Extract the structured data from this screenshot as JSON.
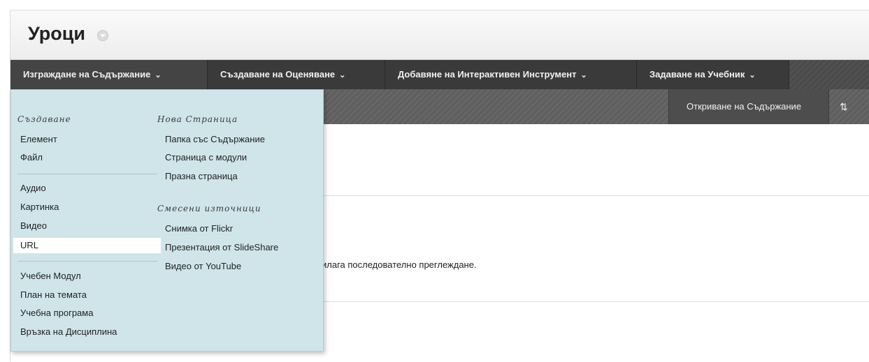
{
  "page": {
    "title": "Уроци"
  },
  "action_bar": {
    "items": [
      {
        "label": "Изграждане на Съдържание",
        "chevron": "⌄"
      },
      {
        "label": "Създаване на Оценяване",
        "chevron": "⌄"
      },
      {
        "label": "Добавяне на Интерактивен Инструмент",
        "chevron": "⌄"
      },
      {
        "label": "Задаване на Учебник",
        "chevron": "⌄"
      }
    ]
  },
  "sub_bar": {
    "open_content_label": "Откриване на Съдържание",
    "sort_icon": "⇅"
  },
  "content": {
    "partial_text": "илага последователно преглеждане."
  },
  "dropdown": {
    "col1_heading": "Създаване",
    "col1_group1": [
      "Елемент",
      "Файл"
    ],
    "col1_group2": [
      "Аудио",
      "Картинка",
      "Видео",
      "URL"
    ],
    "col1_group3": [
      "Учебен Модул",
      "План на темата",
      "Учебна програма",
      "Връзка на Дисциплина"
    ],
    "col2_heading": "Нова Страница",
    "col2_group1": [
      "Папка със Съдържание",
      "Страница с модули",
      "Празна страница"
    ],
    "col2_heading2": "Смесени източници",
    "col2_group2": [
      "Снимка от Flickr",
      "Презентация от SlideShare",
      "Видео от YouTube"
    ],
    "selected_item": "URL"
  },
  "colors": {
    "dropdown_bg": "#cfe5ea",
    "action_bar_bg": "#3a3a3a",
    "selected_item_bg": "#ffffff"
  }
}
